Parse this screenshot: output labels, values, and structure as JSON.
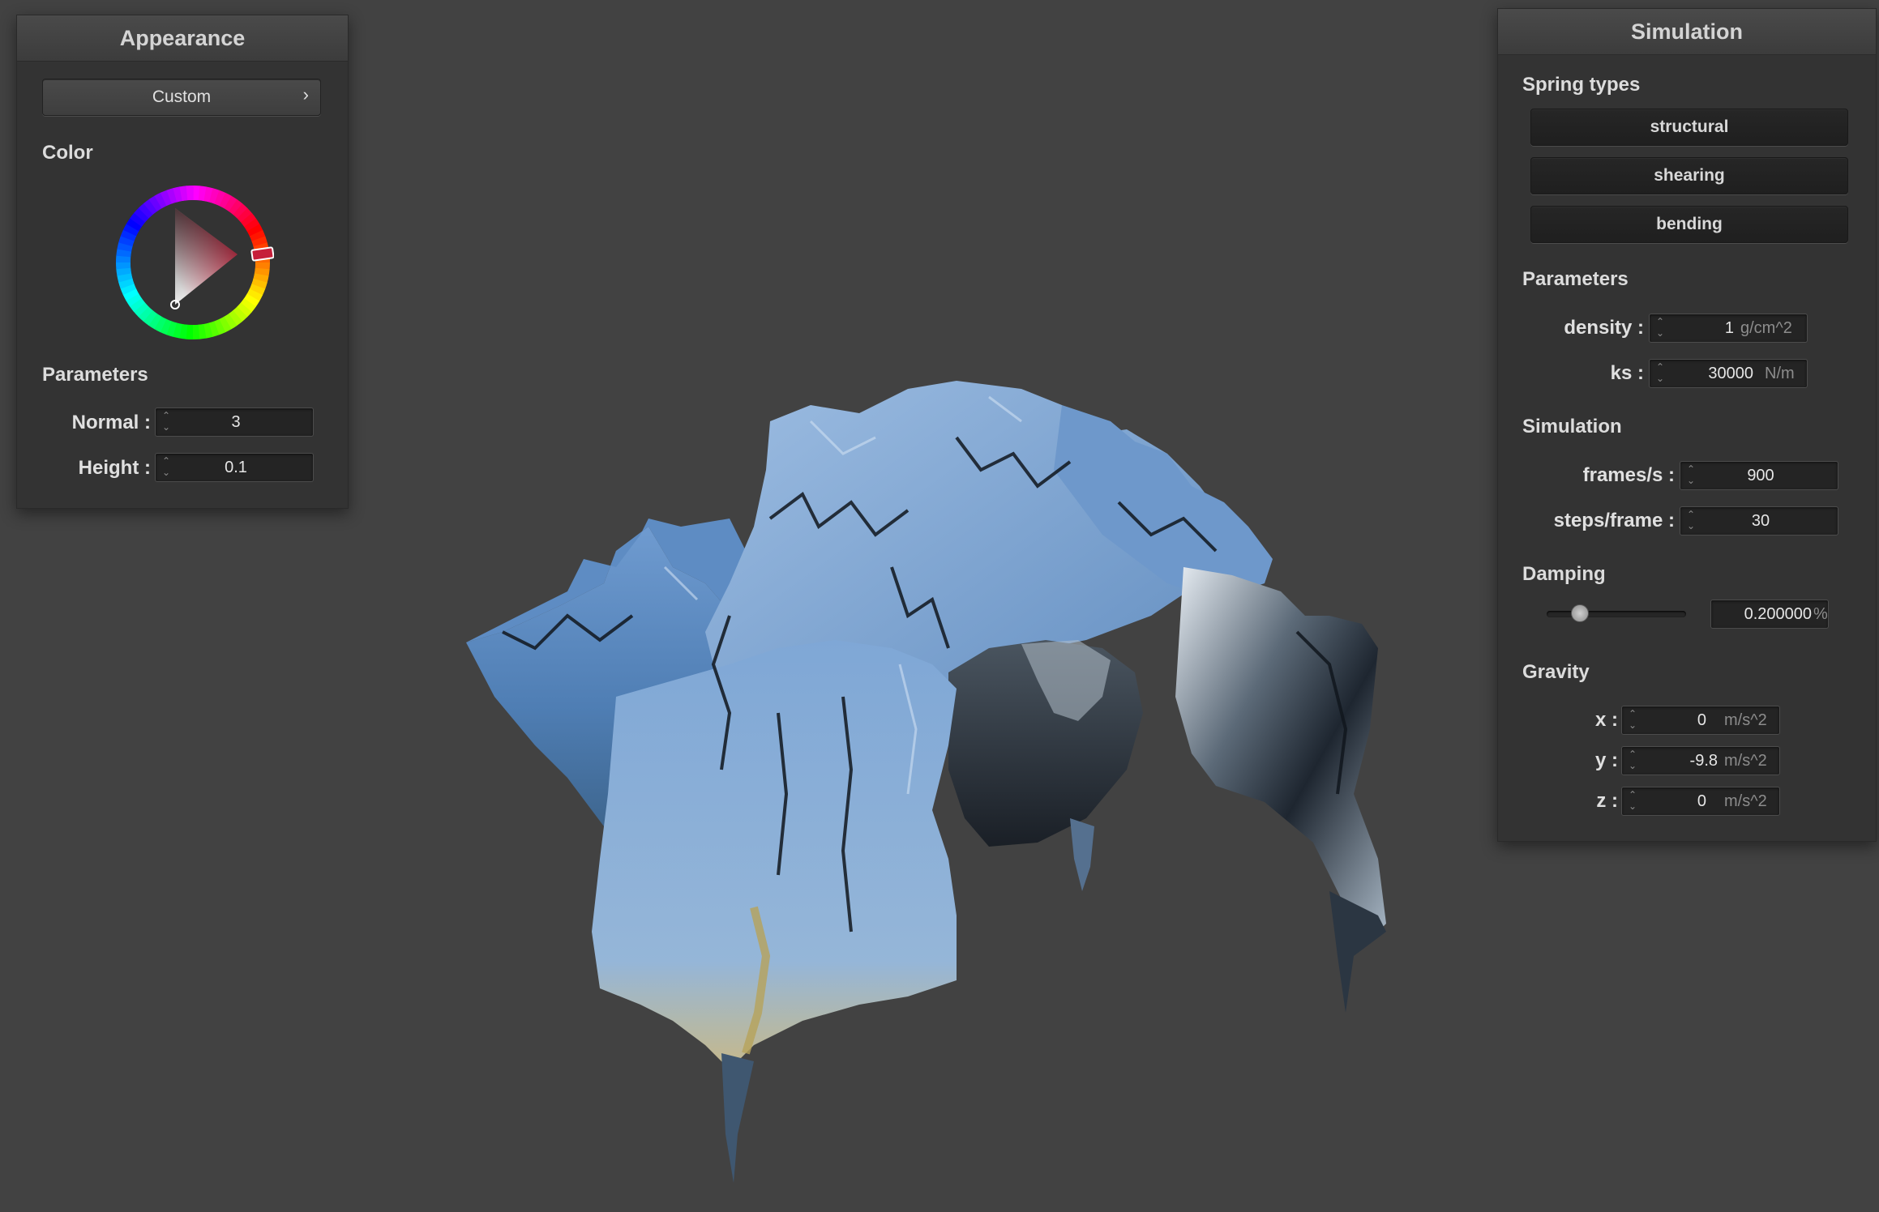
{
  "appearance": {
    "title": "Appearance",
    "preset_label": "Custom",
    "chevron_glyph": "›",
    "color_label": "Color",
    "parameters_label": "Parameters",
    "normal": {
      "label": "Normal :",
      "value": "3"
    },
    "height": {
      "label": "Height :",
      "value": "0.1"
    },
    "selected_color": "#c61f3a"
  },
  "simulation_panel": {
    "title": "Simulation",
    "spring_types_label": "Spring types",
    "spring_types": [
      "structural",
      "shearing",
      "bending"
    ],
    "parameters_label": "Parameters",
    "density": {
      "label": "density :",
      "value": "1",
      "unit": "g/cm^2"
    },
    "ks": {
      "label": "ks :",
      "value": "30000",
      "unit": "N/m"
    },
    "simulation_label": "Simulation",
    "frames_per_s": {
      "label": "frames/s :",
      "value": "900"
    },
    "steps_per_frame": {
      "label": "steps/frame :",
      "value": "30"
    },
    "damping_label": "Damping",
    "damping": {
      "value": "0.200000",
      "unit": "%",
      "slider_fraction": 0.2
    },
    "gravity_label": "Gravity",
    "gravity": {
      "x": {
        "label": "x :",
        "value": "0",
        "unit": "m/s^2"
      },
      "y": {
        "label": "y :",
        "value": "-9.8",
        "unit": "m/s^2"
      },
      "z": {
        "label": "z :",
        "value": "0",
        "unit": "m/s^2"
      }
    }
  },
  "icons": {
    "spin": "spinner-arrows-icon",
    "chevron": "chevron-right-icon"
  },
  "colors": {
    "background": "#424242",
    "panel": "#333333",
    "cloth_light": "#8fb3dc",
    "cloth_mid": "#5a86b8",
    "cloth_dark": "#1d2a3a"
  }
}
